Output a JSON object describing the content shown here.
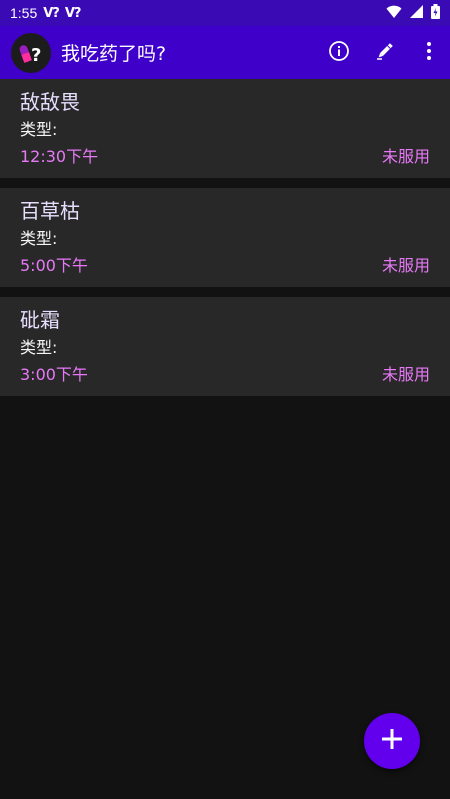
{
  "status_bar": {
    "time": "1:55",
    "notifications": [
      "V?",
      "V?"
    ],
    "icons": [
      "wifi-icon",
      "signal-icon",
      "battery-icon"
    ]
  },
  "app_bar": {
    "title": "我吃药了吗?",
    "logo_icon": "pill-question-logo-icon",
    "actions": [
      "info-icon",
      "edit-pen-icon",
      "more-vert-icon"
    ],
    "colors": {
      "status_bar": "#3a0bb5",
      "app_bar": "#3f00c9"
    }
  },
  "medications": [
    {
      "name": "敌敌畏",
      "type_label": "类型:",
      "time": "12:30下午",
      "status": "未服用"
    },
    {
      "name": "百草枯",
      "type_label": "类型:",
      "time": "5:00下午",
      "status": "未服用"
    },
    {
      "name": "砒霜",
      "type_label": "类型:",
      "time": "3:00下午",
      "status": "未服用"
    }
  ],
  "fab": {
    "icon": "add-icon",
    "color": "#6200ee"
  },
  "colors": {
    "background": "#121212",
    "card": "#282828",
    "accent_text": "#e779f7",
    "title_text": "#e8dfff"
  }
}
